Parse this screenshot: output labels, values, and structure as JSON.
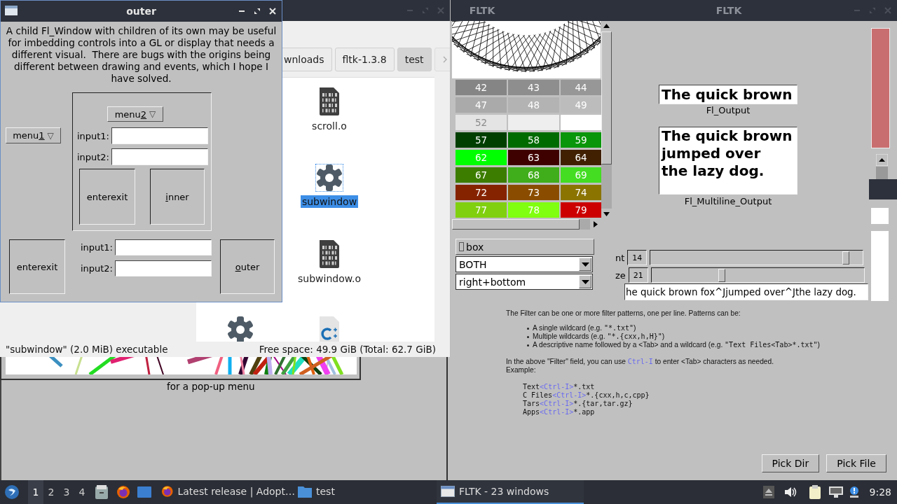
{
  "outer_window": {
    "title": "outer",
    "description": "A child Fl_Window with children of its own may be useful for imbedding controls into a GL or display that needs a different visual.  There are bugs with the origins being different between drawing and events, which I hope I have solved.",
    "menu1": {
      "label_parts": [
        {
          "text": "menu",
          "underlined": false
        },
        {
          "text": "1",
          "underlined": true
        }
      ],
      "arrow": "▽"
    },
    "inner_group": {
      "menu2": {
        "label_parts": [
          {
            "text": "menu",
            "underlined": false
          },
          {
            "text": "2",
            "underlined": true
          }
        ],
        "arrow": "▽"
      },
      "inputs": [
        {
          "label": "input1:"
        },
        {
          "label": "input2:"
        }
      ],
      "enterexit": {
        "label": "enterexit"
      },
      "inner": {
        "label_parts": [
          {
            "text": "i",
            "underlined": true
          },
          {
            "text": "nner",
            "underlined": false
          }
        ]
      }
    },
    "enterexit": {
      "label": "enterexit"
    },
    "inputs": [
      {
        "label": "input1:"
      },
      {
        "label": "input2:"
      }
    ],
    "outer": {
      "label_parts": [
        {
          "text": "o",
          "underlined": true
        },
        {
          "text": "uter",
          "underlined": false
        }
      ]
    }
  },
  "file_manager": {
    "path_buttons": [
      {
        "label": "wnloads",
        "selected": false
      },
      {
        "label": "fltk-1.3.8",
        "selected": false
      },
      {
        "label": "test",
        "selected": true
      }
    ],
    "files": [
      {
        "name": "scroll.o",
        "kind": "binary",
        "selected": false
      },
      {
        "name": "subwindow",
        "kind": "executable",
        "selected": true
      },
      {
        "name": "subwindow.o",
        "kind": "binary",
        "selected": false
      },
      {
        "kind": "executable"
      },
      {
        "kind": "cpp"
      }
    ],
    "status_left": "\"subwindow\" (2.0 MiB) executable",
    "status_right": "Free space: 49.9 GiB (Total: 62.7 GiB)"
  },
  "color_window": {
    "title": "FLTK",
    "rows": [
      [
        {
          "label": "42",
          "color": "#858585"
        },
        {
          "label": "43",
          "color": "#8e8e8e"
        },
        {
          "label": "44",
          "color": "#979797"
        }
      ],
      [
        {
          "label": "47",
          "color": "#aaaaaa"
        },
        {
          "label": "48",
          "color": "#b3b3b3"
        },
        {
          "label": "49",
          "color": "#bcbcbc"
        }
      ],
      [
        {
          "label": "52",
          "color": "#e4e4e4"
        },
        {
          "color": "#eeeeee"
        },
        {
          "color": "#ffffff"
        }
      ],
      [
        {
          "label": "57",
          "color": "#003f00"
        },
        {
          "label": "58",
          "color": "#006b00"
        },
        {
          "label": "59",
          "color": "#0a960a"
        }
      ],
      [
        {
          "label": "62",
          "color": "#00ff00"
        },
        {
          "label": "63",
          "color": "#3f0000"
        },
        {
          "label": "64",
          "color": "#402000"
        }
      ],
      [
        {
          "label": "67",
          "color": "#3c7d00"
        },
        {
          "label": "68",
          "color": "#40ad1a"
        },
        {
          "label": "69",
          "color": "#44dd22"
        }
      ],
      [
        {
          "label": "72",
          "color": "#852300"
        },
        {
          "label": "73",
          "color": "#8a4d00"
        },
        {
          "label": "74",
          "color": "#8b7400"
        }
      ],
      [
        {
          "label": "77",
          "color": "#80d010"
        },
        {
          "label": "78",
          "color": "#80ff10"
        },
        {
          "label": "79",
          "color": "#cc0000"
        }
      ]
    ],
    "checkbox": {
      "label": "box",
      "checked": false
    },
    "choices": [
      {
        "value": "BOTH"
      },
      {
        "value": "right+bottom"
      }
    ]
  },
  "output_window": {
    "title": "FLTK",
    "output": {
      "value": "The quick brown",
      "label": "Fl_Output"
    },
    "multiline": {
      "value": "The quick brown\njumped over\nthe lazy dog.",
      "label": "Fl_Multiline_Output"
    },
    "sliders": [
      {
        "label": "nt",
        "value": "14",
        "level": 0.92
      },
      {
        "label": "ze",
        "value": "21",
        "level": 0.33
      }
    ],
    "input": {
      "value": "he quick brown fox^Jjumped over^Jthe lazy dog."
    }
  },
  "popup_window": {
    "caption": "for a pop-up menu"
  },
  "help_window": {
    "intro": "The Filter can be one or more filter patterns, one per line. Patterns can be:",
    "bullets": [
      [
        {
          "kind": "text",
          "text": "A single wildcard (e.g. "
        },
        {
          "kind": "code",
          "text": "\"*.txt\""
        },
        {
          "kind": "text",
          "text": ")"
        }
      ],
      [
        {
          "kind": "text",
          "text": "Multiple wildcards (e.g. "
        },
        {
          "kind": "code",
          "text": "\"*.{cxx,h,H}\""
        },
        {
          "kind": "text",
          "text": ")"
        }
      ],
      [
        {
          "kind": "text",
          "text": "A descriptive name followed by a <Tab> and a wildcard (e.g. "
        },
        {
          "kind": "code",
          "text": "\"Text Files<Tab>*.txt\""
        },
        {
          "kind": "text",
          "text": ")"
        }
      ]
    ],
    "note": [
      {
        "kind": "text",
        "text": "In the above \"Filter\" field, you can use "
      },
      {
        "kind": "key",
        "text": "Ctrl-I"
      },
      {
        "kind": "text",
        "text": " to enter <Tab> characters as needed."
      }
    ],
    "example_label": "Example:",
    "examples": [
      [
        {
          "kind": "code",
          "text": "Text"
        },
        {
          "kind": "key",
          "text": "<Ctrl-I>"
        },
        {
          "kind": "code",
          "text": "*.txt"
        }
      ],
      [
        {
          "kind": "code",
          "text": "C Files"
        },
        {
          "kind": "key",
          "text": "<Ctrl-I>"
        },
        {
          "kind": "code",
          "text": "*.{cxx,h,c,cpp}"
        }
      ],
      [
        {
          "kind": "code",
          "text": "Tars"
        },
        {
          "kind": "key",
          "text": "<Ctrl-I>"
        },
        {
          "kind": "code",
          "text": "*.{tar,tar.gz}"
        }
      ],
      [
        {
          "kind": "code",
          "text": "Apps"
        },
        {
          "kind": "key",
          "text": "<Ctrl-I>"
        },
        {
          "kind": "code",
          "text": "*.app"
        }
      ]
    ],
    "buttons": [
      "Pick Dir",
      "Pick File"
    ]
  },
  "taskbar": {
    "workspaces": [
      {
        "label": "1",
        "selected": true
      },
      {
        "label": "2",
        "selected": false
      },
      {
        "label": "3",
        "selected": false
      },
      {
        "label": "4",
        "selected": false
      }
    ],
    "tasks": [
      {
        "label": "Latest release | Adopt…",
        "kind": "browser",
        "selected": false
      },
      {
        "label": "test",
        "kind": "folder",
        "selected": false
      },
      {
        "label": "FLTK - 23 windows",
        "kind": "window",
        "selected": true
      }
    ],
    "clock": "9:28"
  }
}
